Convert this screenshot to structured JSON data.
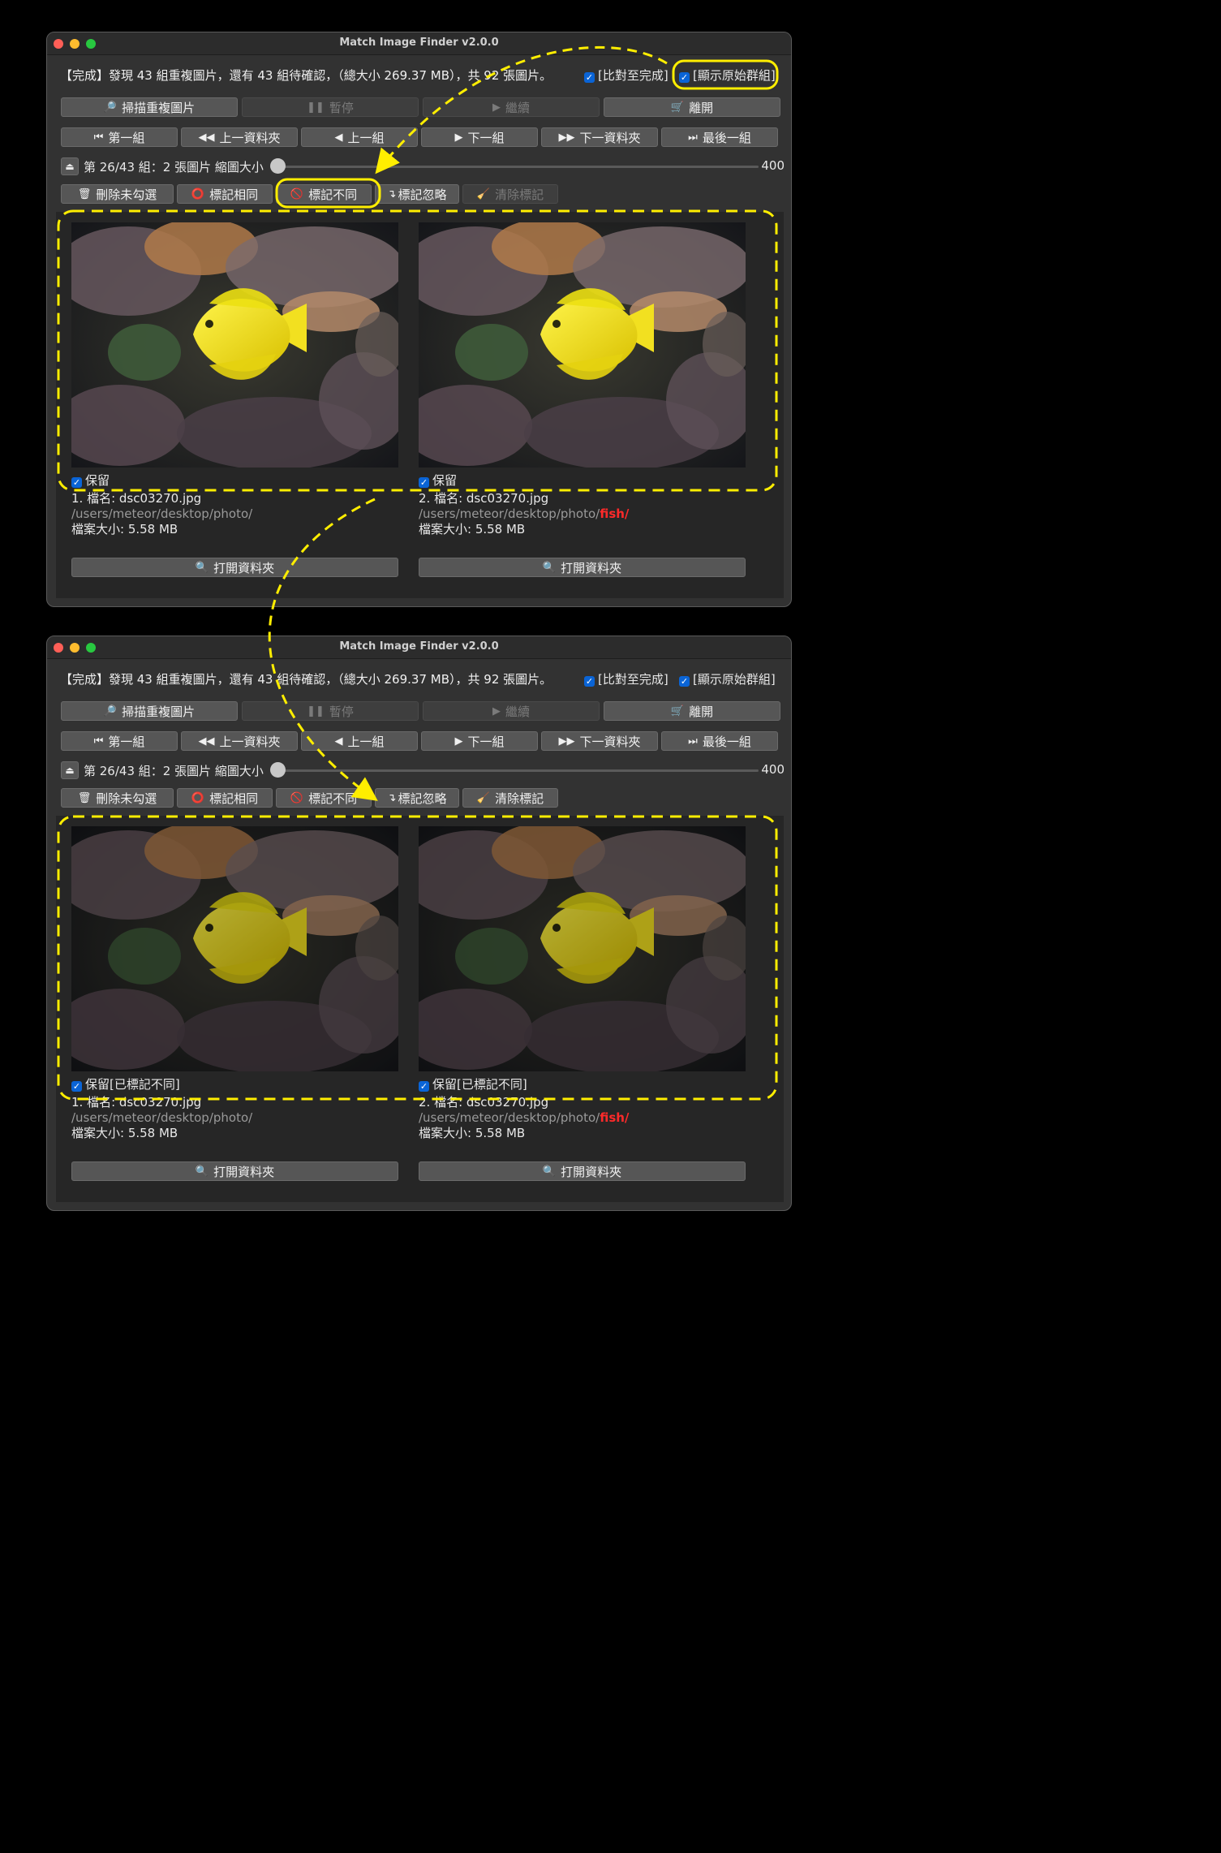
{
  "app_title": "Match Image Finder v2.0.0",
  "status_text": "【完成】發現 43 組重複圖片，還有 43 組待確認，（總大小 269.37 MB），共 92 張圖片。",
  "checkbox_compare": "[比對至完成]",
  "checkbox_original": "[顯示原始群組]",
  "buttons": {
    "scan": "掃描重複圖片",
    "pause": "暫停",
    "resume": "繼續",
    "exit": "離開",
    "first": "第一組",
    "prev_folder": "上一資料夾",
    "prev": "上一組",
    "next": "下一組",
    "next_folder": "下一資料夾",
    "last": "最後一組",
    "delete_unchecked": "刪除未勾選",
    "mark_same": "標記相同",
    "mark_diff": "標記不同",
    "mark_ignore": "標記忽略",
    "clear_mark": "清除標記",
    "open_folder": "打開資料夾"
  },
  "group_info": "第 26/43 組：2 張圖片 縮圖大小",
  "thumb_size": "400",
  "thumb_slider": {
    "min": 0,
    "max": 400,
    "value": 0
  },
  "images": [
    {
      "name": "1. 檔名: dsc03270.jpg",
      "path": "/users/meteor/desktop/photo/",
      "path_highlight": "",
      "size": "檔案大小: 5.58 MB"
    },
    {
      "name": "2. 檔名: dsc03270.jpg",
      "path": "/users/meteor/desktop/photo/",
      "path_highlight": "fish/",
      "size": "檔案大小: 5.58 MB"
    }
  ],
  "keep_before": "保留",
  "keep_after": "保留[已標記不同]",
  "colors": {
    "annotation": "#ffee00",
    "highlight": "#ff2a2a",
    "accent": "#0a64d6"
  }
}
